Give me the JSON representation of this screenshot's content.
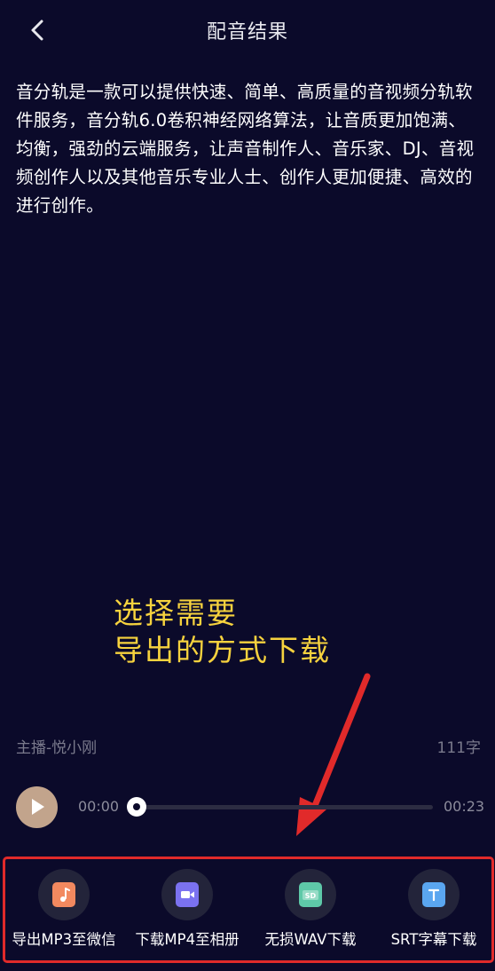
{
  "header": {
    "title": "配音结果",
    "back_icon": "chevron-left-icon"
  },
  "script": {
    "text": "音分轨是一款可以提供快速、简单、高质量的音视频分轨软件服务，音分轨6.0卷积神经网络算法，让音质更加饱满、均衡，强劲的云端服务，让声音制作人、音乐家、DJ、音视频创作人以及其他音乐专业人士、创作人更加便捷、高效的进行创作。"
  },
  "annotation": {
    "line1": "选择需要",
    "line2": "导出的方式下载",
    "color": "#f6d23e"
  },
  "meta": {
    "narrator": "主播-悦小刚",
    "char_count": "111字"
  },
  "player": {
    "current_time": "00:00",
    "total_time": "00:23",
    "progress": 0
  },
  "export_options": [
    {
      "label": "导出MP3至微信",
      "icon": "music-file-icon",
      "color": "#f2895f"
    },
    {
      "label": "下载MP4至相册",
      "icon": "video-file-icon",
      "color": "#7b72f0"
    },
    {
      "label": "无损WAV下载",
      "icon": "sd-file-icon",
      "color": "#5ec9a8"
    },
    {
      "label": "SRT字幕下载",
      "icon": "text-file-icon",
      "color": "#5aa6f0"
    }
  ],
  "colors": {
    "background": "#0b0a2a",
    "highlight_border": "#e12a2a",
    "play_button": "#c2a48c"
  }
}
